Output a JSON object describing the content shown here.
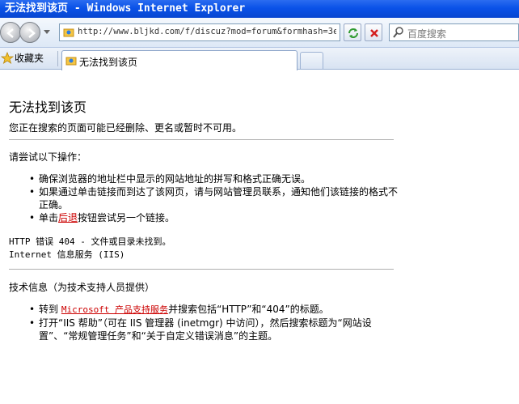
{
  "window": {
    "title": "无法找到该页 - Windows Internet Explorer"
  },
  "nav": {
    "address": "http://www.bljkd.com/f/discuz?mod=forum&formhash=3e",
    "search_placeholder": "百度搜索"
  },
  "tabbar": {
    "favorites_label": "收藏夹",
    "tab_label": "无法找到该页"
  },
  "page": {
    "title": "无法找到该页",
    "subtitle": "您正在搜索的页面可能已经删除、更名或暂时不可用。",
    "try_heading": "请尝试以下操作：",
    "try_items": {
      "item1": "确保浏览器的地址栏中显示的网站地址的拼写和格式正确无误。",
      "item2": "如果通过单击链接而到达了该网页，请与网站管理员联系，通知他们该链接的格式不正确。",
      "item3_pre": "单击",
      "item3_link": "后退",
      "item3_post": "按钮尝试另一个链接。"
    },
    "error_line1": "HTTP 错误 404 - 文件或目录未找到。",
    "error_line2": "Internet 信息服务 (IIS)",
    "tech_heading": "技术信息（为技术支持人员提供）",
    "tech_items": {
      "item1_pre": "转到 ",
      "item1_link": "Microsoft 产品支持服务",
      "item1_post": "并搜索包括“HTTP”和“404”的标题。",
      "item2": "打开“IIS 帮助”（可在 IIS 管理器 (inetmgr) 中访问），然后搜索标题为“网站设置”、“常规管理任务”和“关于自定义错误消息”的主题。"
    },
    "bullet": "•"
  },
  "colors": {
    "titlebar": "#0a52e8",
    "link": "#cc0000"
  }
}
